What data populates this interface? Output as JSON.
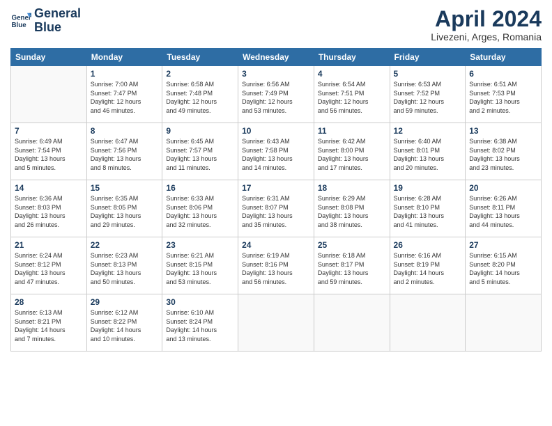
{
  "logo": {
    "line1": "General",
    "line2": "Blue"
  },
  "title": "April 2024",
  "location": "Livezeni, Arges, Romania",
  "weekdays": [
    "Sunday",
    "Monday",
    "Tuesday",
    "Wednesday",
    "Thursday",
    "Friday",
    "Saturday"
  ],
  "weeks": [
    [
      {
        "day": "",
        "info": ""
      },
      {
        "day": "1",
        "info": "Sunrise: 7:00 AM\nSunset: 7:47 PM\nDaylight: 12 hours\nand 46 minutes."
      },
      {
        "day": "2",
        "info": "Sunrise: 6:58 AM\nSunset: 7:48 PM\nDaylight: 12 hours\nand 49 minutes."
      },
      {
        "day": "3",
        "info": "Sunrise: 6:56 AM\nSunset: 7:49 PM\nDaylight: 12 hours\nand 53 minutes."
      },
      {
        "day": "4",
        "info": "Sunrise: 6:54 AM\nSunset: 7:51 PM\nDaylight: 12 hours\nand 56 minutes."
      },
      {
        "day": "5",
        "info": "Sunrise: 6:53 AM\nSunset: 7:52 PM\nDaylight: 12 hours\nand 59 minutes."
      },
      {
        "day": "6",
        "info": "Sunrise: 6:51 AM\nSunset: 7:53 PM\nDaylight: 13 hours\nand 2 minutes."
      }
    ],
    [
      {
        "day": "7",
        "info": "Sunrise: 6:49 AM\nSunset: 7:54 PM\nDaylight: 13 hours\nand 5 minutes."
      },
      {
        "day": "8",
        "info": "Sunrise: 6:47 AM\nSunset: 7:56 PM\nDaylight: 13 hours\nand 8 minutes."
      },
      {
        "day": "9",
        "info": "Sunrise: 6:45 AM\nSunset: 7:57 PM\nDaylight: 13 hours\nand 11 minutes."
      },
      {
        "day": "10",
        "info": "Sunrise: 6:43 AM\nSunset: 7:58 PM\nDaylight: 13 hours\nand 14 minutes."
      },
      {
        "day": "11",
        "info": "Sunrise: 6:42 AM\nSunset: 8:00 PM\nDaylight: 13 hours\nand 17 minutes."
      },
      {
        "day": "12",
        "info": "Sunrise: 6:40 AM\nSunset: 8:01 PM\nDaylight: 13 hours\nand 20 minutes."
      },
      {
        "day": "13",
        "info": "Sunrise: 6:38 AM\nSunset: 8:02 PM\nDaylight: 13 hours\nand 23 minutes."
      }
    ],
    [
      {
        "day": "14",
        "info": "Sunrise: 6:36 AM\nSunset: 8:03 PM\nDaylight: 13 hours\nand 26 minutes."
      },
      {
        "day": "15",
        "info": "Sunrise: 6:35 AM\nSunset: 8:05 PM\nDaylight: 13 hours\nand 29 minutes."
      },
      {
        "day": "16",
        "info": "Sunrise: 6:33 AM\nSunset: 8:06 PM\nDaylight: 13 hours\nand 32 minutes."
      },
      {
        "day": "17",
        "info": "Sunrise: 6:31 AM\nSunset: 8:07 PM\nDaylight: 13 hours\nand 35 minutes."
      },
      {
        "day": "18",
        "info": "Sunrise: 6:29 AM\nSunset: 8:08 PM\nDaylight: 13 hours\nand 38 minutes."
      },
      {
        "day": "19",
        "info": "Sunrise: 6:28 AM\nSunset: 8:10 PM\nDaylight: 13 hours\nand 41 minutes."
      },
      {
        "day": "20",
        "info": "Sunrise: 6:26 AM\nSunset: 8:11 PM\nDaylight: 13 hours\nand 44 minutes."
      }
    ],
    [
      {
        "day": "21",
        "info": "Sunrise: 6:24 AM\nSunset: 8:12 PM\nDaylight: 13 hours\nand 47 minutes."
      },
      {
        "day": "22",
        "info": "Sunrise: 6:23 AM\nSunset: 8:13 PM\nDaylight: 13 hours\nand 50 minutes."
      },
      {
        "day": "23",
        "info": "Sunrise: 6:21 AM\nSunset: 8:15 PM\nDaylight: 13 hours\nand 53 minutes."
      },
      {
        "day": "24",
        "info": "Sunrise: 6:19 AM\nSunset: 8:16 PM\nDaylight: 13 hours\nand 56 minutes."
      },
      {
        "day": "25",
        "info": "Sunrise: 6:18 AM\nSunset: 8:17 PM\nDaylight: 13 hours\nand 59 minutes."
      },
      {
        "day": "26",
        "info": "Sunrise: 6:16 AM\nSunset: 8:19 PM\nDaylight: 14 hours\nand 2 minutes."
      },
      {
        "day": "27",
        "info": "Sunrise: 6:15 AM\nSunset: 8:20 PM\nDaylight: 14 hours\nand 5 minutes."
      }
    ],
    [
      {
        "day": "28",
        "info": "Sunrise: 6:13 AM\nSunset: 8:21 PM\nDaylight: 14 hours\nand 7 minutes."
      },
      {
        "day": "29",
        "info": "Sunrise: 6:12 AM\nSunset: 8:22 PM\nDaylight: 14 hours\nand 10 minutes."
      },
      {
        "day": "30",
        "info": "Sunrise: 6:10 AM\nSunset: 8:24 PM\nDaylight: 14 hours\nand 13 minutes."
      },
      {
        "day": "",
        "info": ""
      },
      {
        "day": "",
        "info": ""
      },
      {
        "day": "",
        "info": ""
      },
      {
        "day": "",
        "info": ""
      }
    ]
  ]
}
